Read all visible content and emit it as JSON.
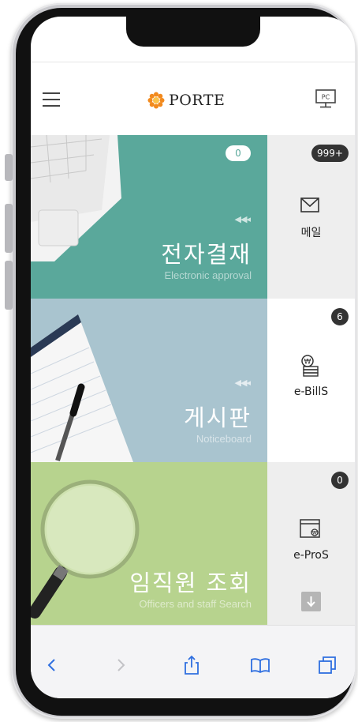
{
  "app": {
    "brand": "PORTE",
    "colors": {
      "approval": "#5aa89b",
      "board": "#a9c4cf",
      "search": "#b7d38e",
      "ios_blue": "#2f6fe0"
    }
  },
  "header": {
    "menu_icon": "hamburger-icon",
    "pc_label": "PC"
  },
  "tiles": [
    {
      "title": "전자결재",
      "subtitle": "Electronic approval",
      "badge": "0"
    },
    {
      "title": "게시판",
      "subtitle": "Noticeboard"
    },
    {
      "title": "임직원 조회",
      "subtitle": "Officers and staff Search"
    }
  ],
  "side": [
    {
      "label": "메일",
      "badge": "999+",
      "icon": "mail-icon"
    },
    {
      "label": "e-BillS",
      "badge": "6",
      "icon": "coins-icon"
    },
    {
      "label": "e-ProS",
      "badge": "0",
      "icon": "pro-window-icon"
    }
  ],
  "toolbar": {
    "icons": [
      "back-icon",
      "forward-icon",
      "share-icon",
      "bookmarks-icon",
      "tabs-icon"
    ]
  }
}
